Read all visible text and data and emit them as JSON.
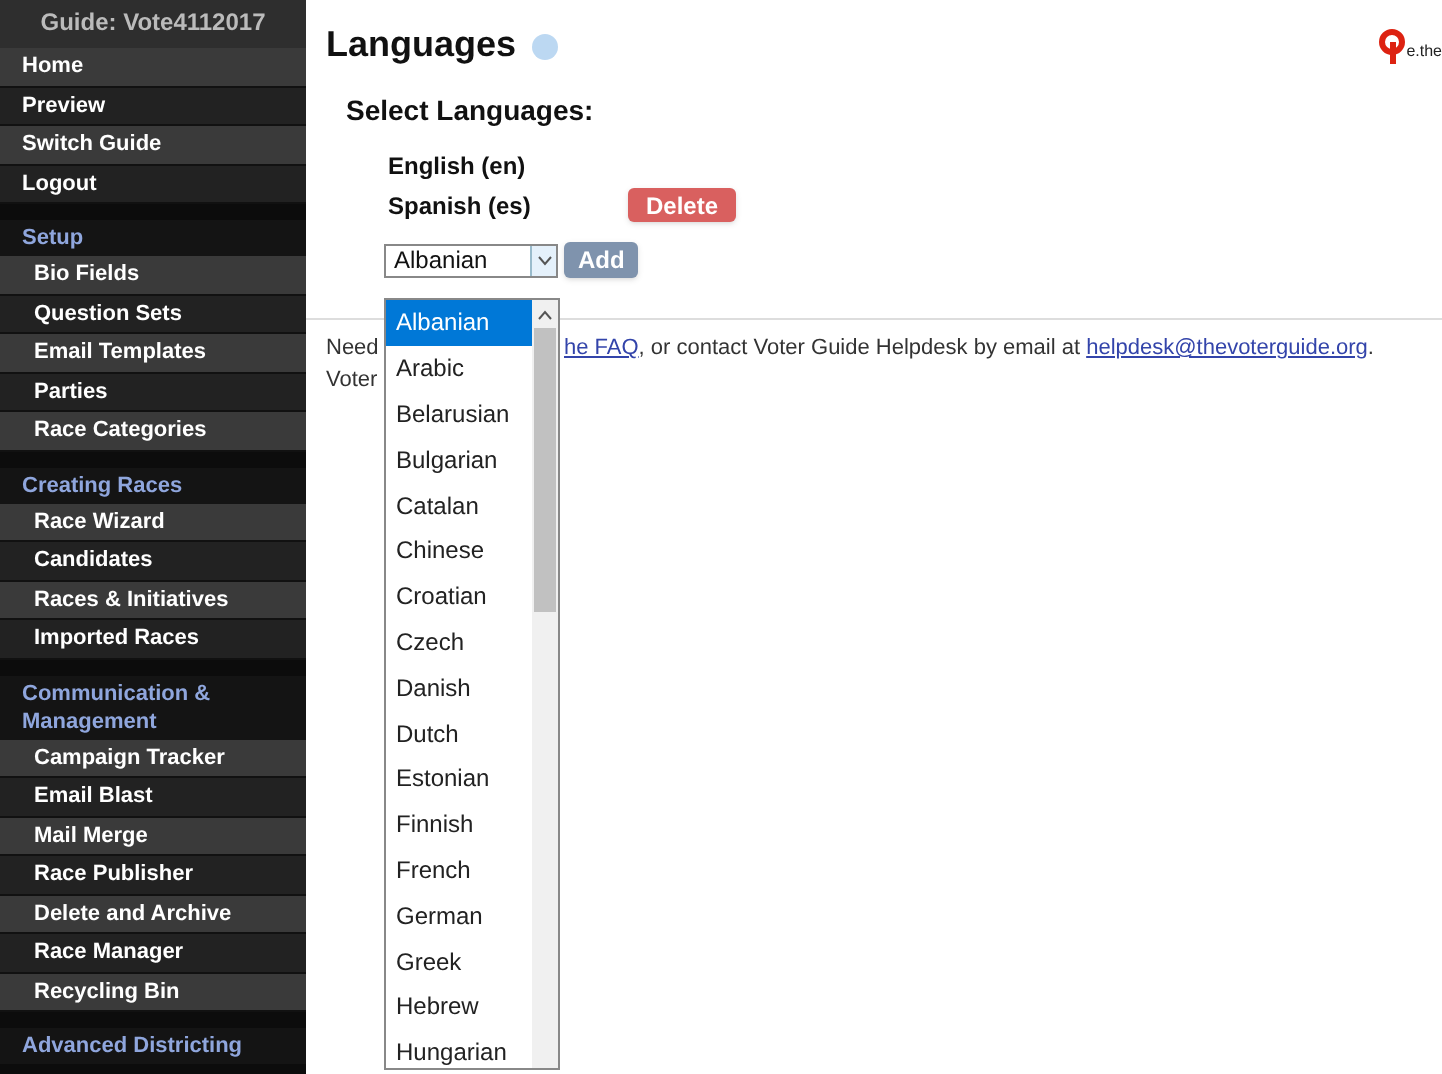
{
  "sidebar": {
    "guide_label": "Guide: Vote4112017",
    "sections": [
      {
        "items": [
          "Home",
          "Preview",
          "Switch Guide",
          "Logout"
        ]
      },
      {
        "heading": "Setup",
        "items": [
          "Bio Fields",
          "Question Sets",
          "Email Templates",
          "Parties",
          "Race Categories"
        ]
      },
      {
        "heading": "Creating Races",
        "items": [
          "Race Wizard",
          "Candidates",
          "Races & Initiatives",
          "Imported Races"
        ]
      },
      {
        "heading": "Communication & Management",
        "items": [
          "Campaign Tracker",
          "Email Blast",
          "Mail Merge",
          "Race Publisher",
          "Delete and Archive",
          "Race Manager",
          "Recycling Bin"
        ]
      },
      {
        "heading": "Advanced Districting"
      }
    ]
  },
  "page": {
    "title": "Languages",
    "logo_text": "e.the",
    "select_label": "Select Languages:",
    "languages": [
      {
        "name": "English (en)",
        "deletable": false
      },
      {
        "name": "Spanish (es)",
        "deletable": true
      }
    ],
    "delete_button": "Delete",
    "dropdown": {
      "value": "Albanian",
      "add_button": "Add",
      "expanded": true,
      "options": [
        {
          "label": "Albanian",
          "selected": true
        },
        {
          "label": "Arabic",
          "selected": false
        },
        {
          "label": "Belarusian",
          "selected": false
        },
        {
          "label": "Bulgarian",
          "selected": false
        },
        {
          "label": "Catalan",
          "selected": false
        },
        {
          "label": "Chinese",
          "selected": false
        },
        {
          "label": "Croatian",
          "selected": false
        },
        {
          "label": "Czech",
          "selected": false
        },
        {
          "label": "Danish",
          "selected": false
        },
        {
          "label": "Dutch",
          "selected": false
        },
        {
          "label": "Estonian",
          "selected": false
        },
        {
          "label": "Finnish",
          "selected": false
        },
        {
          "label": "French",
          "selected": false
        },
        {
          "label": "German",
          "selected": false
        },
        {
          "label": "Greek",
          "selected": false
        },
        {
          "label": "Hebrew",
          "selected": false
        },
        {
          "label": "Hungarian",
          "selected": false
        }
      ]
    },
    "help": {
      "left_lines": [
        "Need",
        "Voter"
      ],
      "link_faq": "he FAQ",
      "text": ", or contact Voter Guide Helpdesk by email at",
      "link_email": "helpdesk@thevoterguide.org",
      "end": "."
    }
  }
}
